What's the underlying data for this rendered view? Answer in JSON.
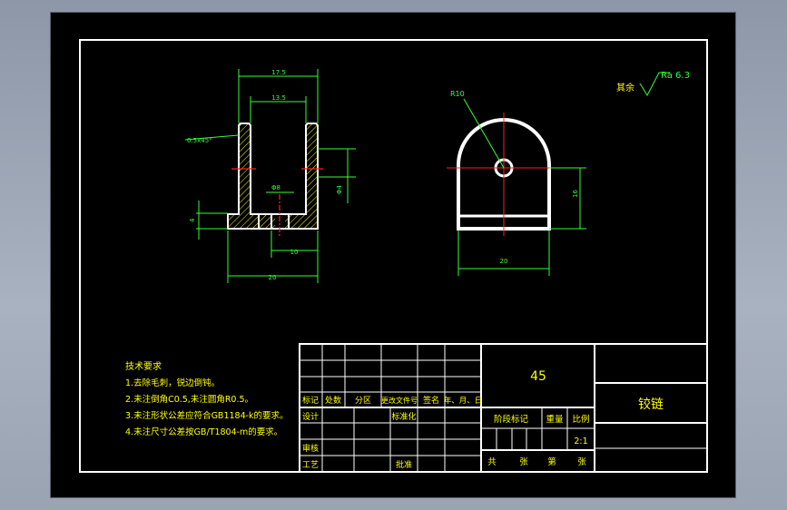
{
  "colors": {
    "background": "#000000",
    "border": "#ffffff",
    "part_outline": "#ffffff",
    "dimension": "#33ff33",
    "centerline": "#ff2020",
    "hatch": "#ffff00",
    "text_yellow": "#ffff00",
    "text_green": "#33ff33",
    "window_bg": "#9aa3b2"
  },
  "front_view": {
    "dims": {
      "overall_top_width": "17.5",
      "inner_width": "13.5",
      "chamfer": "0.5x45°",
      "slot": "Φ8",
      "height_right": "Φ4",
      "base_thickness": "4",
      "slot_width": "10",
      "overall_width": "20"
    }
  },
  "side_view": {
    "dims": {
      "radius": "R10",
      "height": "16",
      "width": "20"
    }
  },
  "roughness": {
    "prefix": "其余",
    "value": "Ra 6.3"
  },
  "notes": {
    "title": "技术要求",
    "items": [
      "1.去除毛刺，锐边倒钝。",
      "2.未注倒角C0.5,未注圆角R0.5。",
      "3.未注形状公差应符合GB1184-k的要求。",
      "4.未注尺寸公差按GB/T1804-m的要求。"
    ]
  },
  "title_block": {
    "material": "45",
    "part_name": "铰链",
    "revision_headers": [
      "标记",
      "处数",
      "分区",
      "更改文件号",
      "签名",
      "年、月、日"
    ],
    "rows": {
      "design": "设计",
      "standardize": "标准化",
      "review": "审核",
      "process": "工艺",
      "approve": "批准"
    },
    "stage_label": "阶段标记",
    "weight_label": "重量",
    "scale_label": "比例",
    "scale_value": "2:1",
    "sheets": {
      "total_a": "共",
      "total_b": "张",
      "page_a": "第",
      "page_b": "张"
    }
  }
}
